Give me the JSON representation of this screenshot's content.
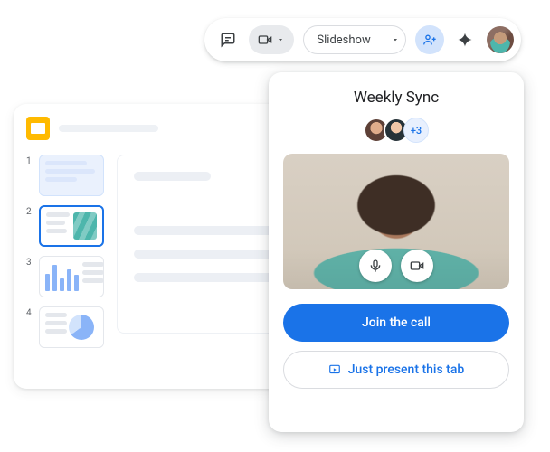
{
  "topbar": {
    "slideshow_label": "Slideshow"
  },
  "editor": {
    "slide_numbers": [
      "1",
      "2",
      "3",
      "4"
    ]
  },
  "meet": {
    "title": "Weekly Sync",
    "extra_attendees": "+3",
    "join_label": "Join the call",
    "present_label": "Just present this tab"
  }
}
